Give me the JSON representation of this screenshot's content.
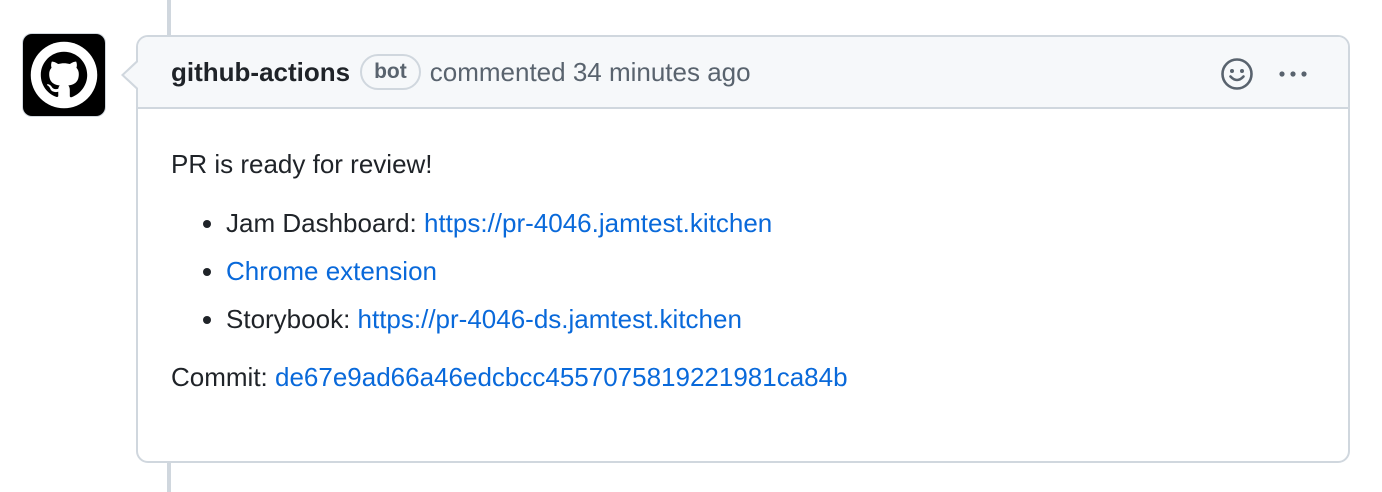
{
  "comment": {
    "author": "github-actions",
    "badge": "bot",
    "meta": "commented 34 minutes ago",
    "intro": "PR is ready for review!",
    "links": [
      {
        "label": "Jam Dashboard: ",
        "link_text": "https://pr-4046.jamtest.kitchen"
      },
      {
        "label": "",
        "link_text": "Chrome extension"
      },
      {
        "label": "Storybook: ",
        "link_text": "https://pr-4046-ds.jamtest.kitchen"
      }
    ],
    "commit_label": "Commit: ",
    "commit_hash": "de67e9ad66a46edcbcc4557075819221981ca84b"
  },
  "icons": {
    "avatar": "github-logo-icon",
    "reaction": "smiley-icon",
    "more": "kebab-horizontal-icon"
  },
  "colors": {
    "link": "#0969da",
    "border": "#d0d7de",
    "header_bg": "#f6f8fa",
    "muted": "#59636e"
  }
}
